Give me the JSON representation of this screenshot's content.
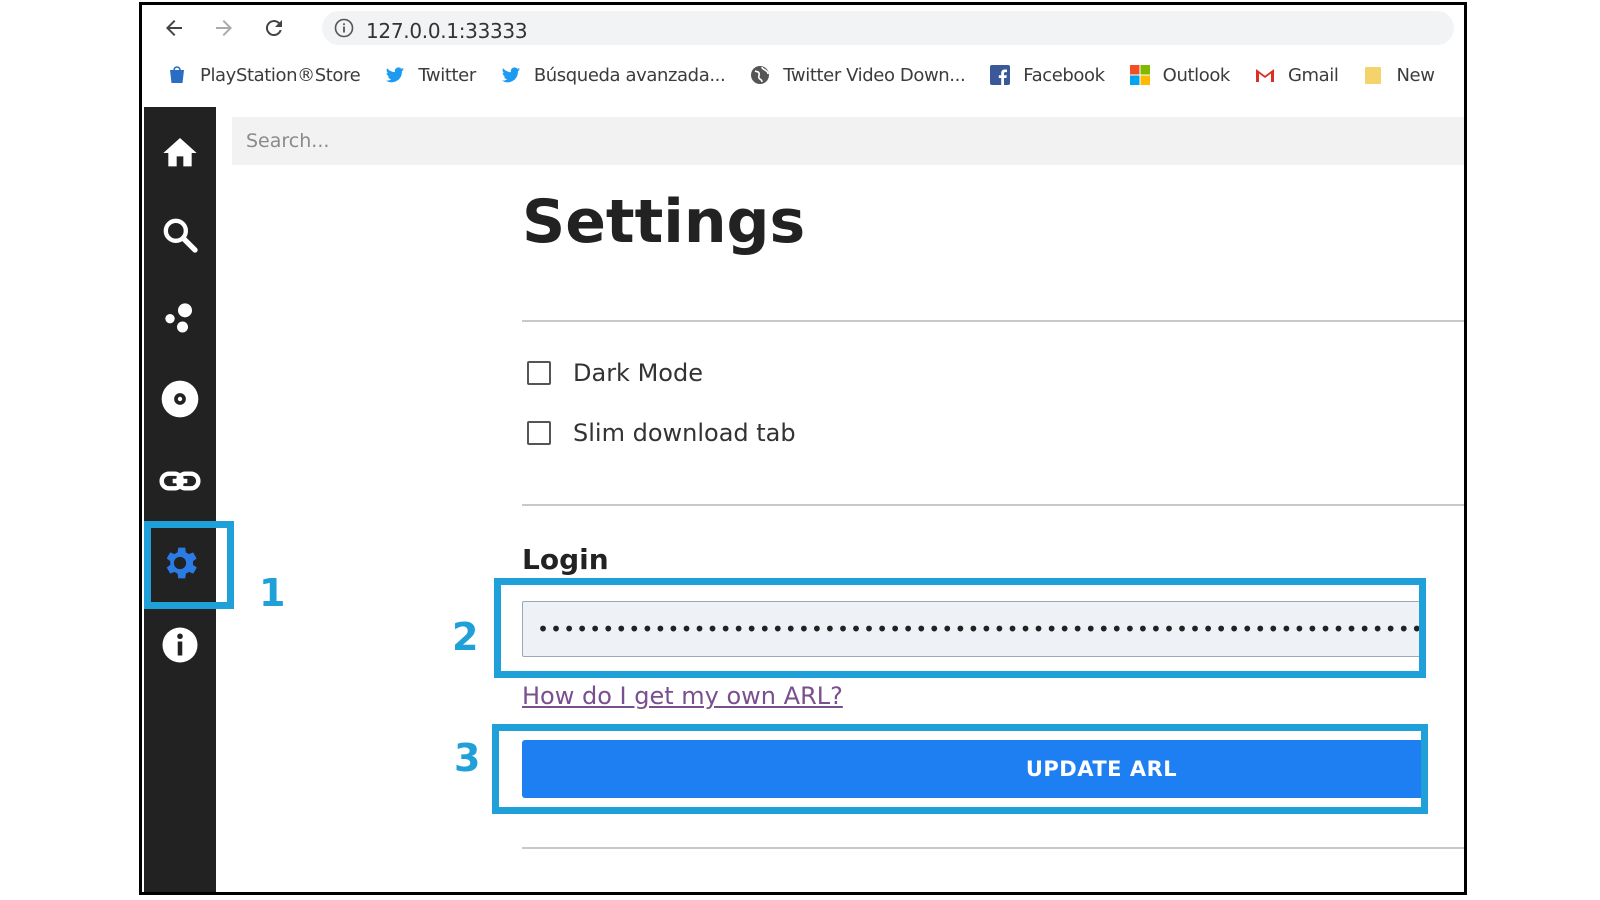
{
  "browser": {
    "url": "127.0.0.1:33333",
    "bookmarks": [
      {
        "label": "PlayStation®Store",
        "icon": "playstation-store-icon"
      },
      {
        "label": "Twitter",
        "icon": "twitter-bird-icon"
      },
      {
        "label": "Búsqueda avanzada...",
        "icon": "twitter-bird-icon"
      },
      {
        "label": "Twitter Video Down...",
        "icon": "globe-icon"
      },
      {
        "label": "Facebook",
        "icon": "facebook-icon"
      },
      {
        "label": "Outlook",
        "icon": "microsoft-icon"
      },
      {
        "label": "Gmail",
        "icon": "gmail-icon"
      },
      {
        "label": "New",
        "icon": "folder-icon"
      }
    ]
  },
  "sidebar": {
    "items": [
      {
        "icon": "home-icon"
      },
      {
        "icon": "search-icon"
      },
      {
        "icon": "charts-icon"
      },
      {
        "icon": "disc-icon"
      },
      {
        "icon": "link-icon"
      },
      {
        "icon": "gear-icon",
        "active": true
      },
      {
        "icon": "info-icon"
      }
    ]
  },
  "search": {
    "placeholder": "Search..."
  },
  "settings": {
    "title": "Settings",
    "options": [
      {
        "label": "Dark Mode",
        "checked": false
      },
      {
        "label": "Slim download tab",
        "checked": false
      }
    ],
    "login": {
      "title": "Login",
      "arl_value": "••••••••••••••••••••••••••••••••••••••••••••••••••••••••••••••••••••••",
      "help_link": "How do I get my own ARL?",
      "update_button": "UPDATE ARL"
    }
  },
  "annotations": [
    "1",
    "2",
    "3"
  ],
  "colors": {
    "accent": "#1e7ff2",
    "annotation": "#1fa0d8",
    "sidebar_bg": "#222222",
    "active_icon": "#2a7be4"
  }
}
